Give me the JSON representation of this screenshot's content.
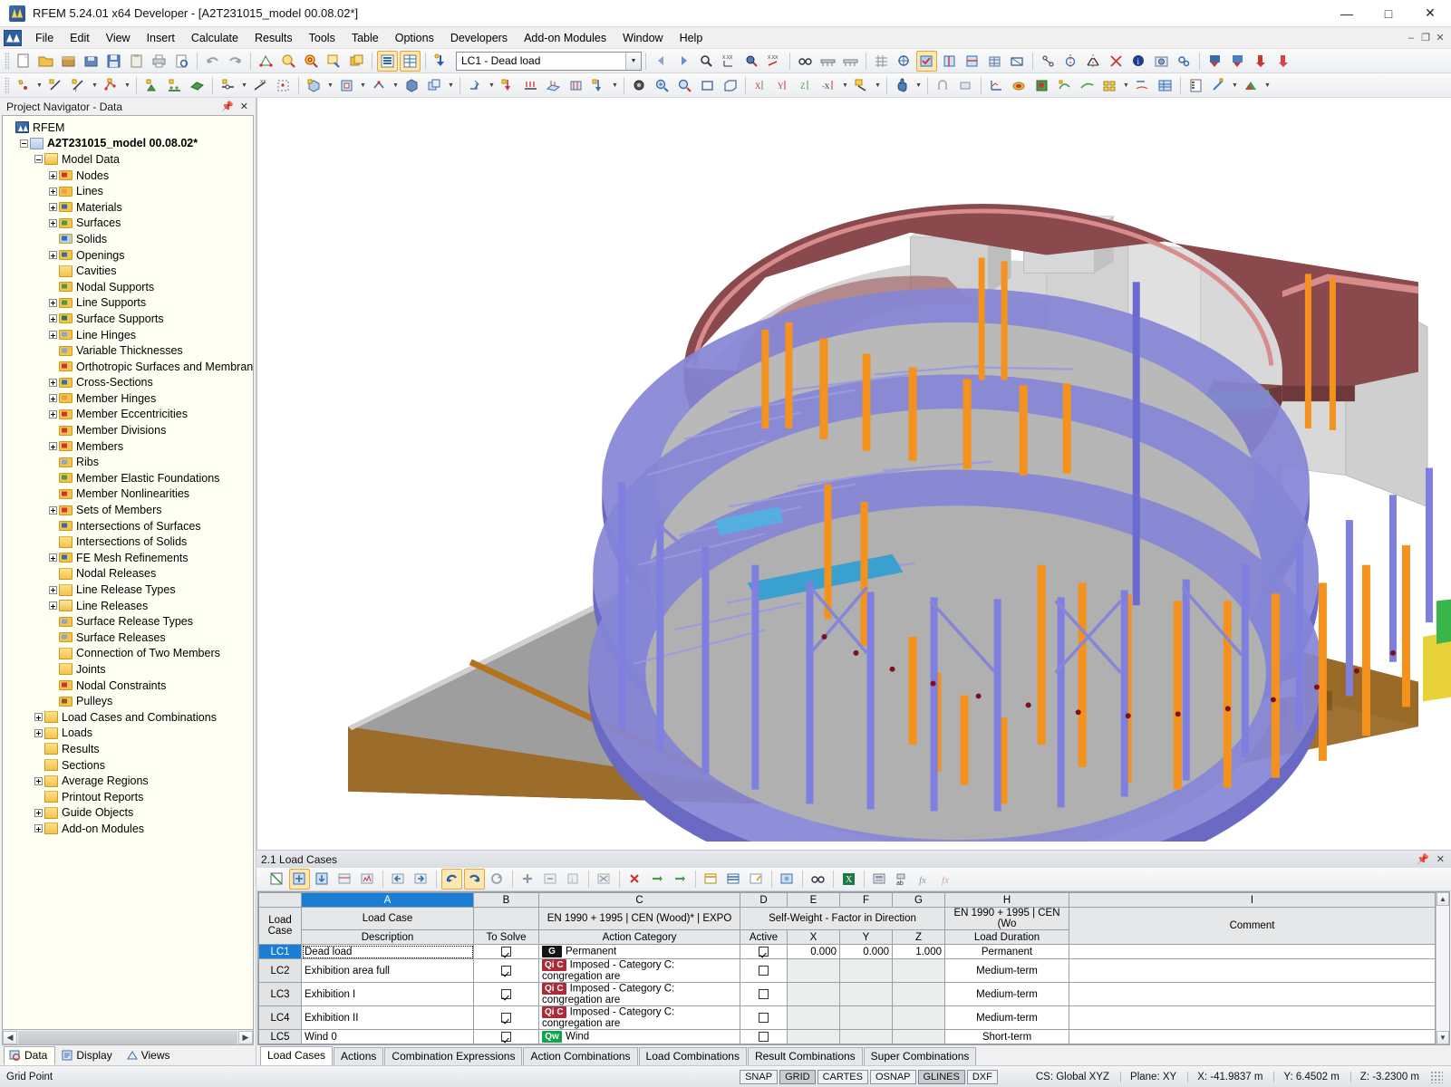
{
  "window": {
    "title": "RFEM 5.24.01 x64 Developer - [A2T231015_model 00.08.02*]",
    "minimize": "—",
    "maximize": "□",
    "close": "✕",
    "mdi_minimize": "–",
    "mdi_restore": "❐",
    "mdi_close": "✕"
  },
  "menu": {
    "logo_icon": "rfem-logo-icon",
    "items": [
      "File",
      "Edit",
      "View",
      "Insert",
      "Calculate",
      "Results",
      "Tools",
      "Table",
      "Options",
      "Developers",
      "Add-on Modules",
      "Window",
      "Help"
    ]
  },
  "toolbar": {
    "load_case_selector": "LC1 - Dead load",
    "row1_icons": [
      "new-file-icon",
      "open-folder-icon",
      "open-package-icon",
      "save-package-icon",
      "save-icon",
      "clipboard-icon",
      "print-icon",
      "print-preview-icon",
      "undo-icon",
      "redo-icon",
      "render-icon",
      "zoom-detail-icon",
      "zoom-target-icon",
      "zoom-window-icon",
      "copy-window-icon",
      "table-list-icon",
      "table-grid-icon",
      "load-case-icon"
    ],
    "row1b_icons": [
      "prev-arrow-icon",
      "next-arrow-icon",
      "pick-point-icon",
      "dimension-icon",
      "target-point-icon",
      "coord-icon",
      "glasses-icon",
      "bridge-icon",
      "bridge2-icon",
      "mesh-icon",
      "fe-mesh-icon",
      "calc-icon",
      "calc2-icon",
      "calc3-icon",
      "building-icon",
      "frame-icon",
      "node-link-icon",
      "circle-mirror-icon",
      "mirror-icon",
      "intersect-icon",
      "info-icon",
      "photo-icon",
      "gears-icon",
      "down-blue-icon",
      "down-blue2-icon",
      "down-red-icon",
      "down-red2-icon"
    ],
    "row2_icons": [
      "node-icon",
      "line-icon",
      "line-dim-icon",
      "polyline-icon",
      "support-icon",
      "support-node-icon",
      "surface-icon",
      "member-hinge-icon",
      "eccentricity-icon",
      "division-icon",
      "solid-icon",
      "opening-icon",
      "member-icon",
      "cube-icon",
      "copy-solid-icon",
      "move-icon",
      "nodal-load-icon",
      "line-load-icon",
      "surface-load-icon",
      "free-load-icon",
      "snap-icon"
    ],
    "row2b_icons": [
      "mesh-gear-icon",
      "zoom-in-icon",
      "zoom-out-icon",
      "box-icon",
      "box3d-icon",
      "axis-x-icon",
      "axis-y-icon",
      "axis-z-icon",
      "axis-xi-icon",
      "render-mode-icon",
      "hand-icon",
      "joint-icon",
      "link-icon",
      "diagram-icon",
      "contour-icon",
      "solid-result-icon",
      "deform-icon",
      "iso-icon",
      "color-table-icon",
      "section-icon",
      "result-table-icon",
      "legend-icon",
      "magic-icon",
      "colors-icon"
    ]
  },
  "navigator": {
    "title": "Project Navigator - Data",
    "pin_icon": "pin-icon",
    "close_icon": "close-icon",
    "tabs": [
      {
        "label": "Data",
        "icon": "data-icon",
        "active": true
      },
      {
        "label": "Display",
        "icon": "display-icon",
        "active": false
      },
      {
        "label": "Views",
        "icon": "views-icon",
        "active": false
      }
    ],
    "tree": [
      {
        "label": "RFEM",
        "depth": 0,
        "toggle": "none",
        "icon": "rfem-icon",
        "bold": false
      },
      {
        "label": "A2T231015_model 00.08.02*",
        "depth": 1,
        "toggle": "minus",
        "icon": "model-icon",
        "bold": true
      },
      {
        "label": "Model Data",
        "depth": 2,
        "toggle": "minus",
        "icon": "folder-open",
        "bold": false
      },
      {
        "label": "Nodes",
        "depth": 3,
        "toggle": "plus",
        "icon": "nodes-icon",
        "bold": false
      },
      {
        "label": "Lines",
        "depth": 3,
        "toggle": "plus",
        "icon": "lines-icon",
        "bold": false
      },
      {
        "label": "Materials",
        "depth": 3,
        "toggle": "plus",
        "icon": "materials-icon",
        "bold": false
      },
      {
        "label": "Surfaces",
        "depth": 3,
        "toggle": "plus",
        "icon": "surfaces-icon",
        "bold": false
      },
      {
        "label": "Solids",
        "depth": 3,
        "toggle": "none",
        "icon": "solids-icon",
        "bold": false
      },
      {
        "label": "Openings",
        "depth": 3,
        "toggle": "plus",
        "icon": "openings-icon",
        "bold": false
      },
      {
        "label": "Cavities",
        "depth": 3,
        "toggle": "none",
        "icon": "folder",
        "bold": false
      },
      {
        "label": "Nodal Supports",
        "depth": 3,
        "toggle": "none",
        "icon": "nodal-supports-icon",
        "bold": false
      },
      {
        "label": "Line Supports",
        "depth": 3,
        "toggle": "plus",
        "icon": "line-supports-icon",
        "bold": false
      },
      {
        "label": "Surface Supports",
        "depth": 3,
        "toggle": "plus",
        "icon": "surface-supports-icon",
        "bold": false
      },
      {
        "label": "Line Hinges",
        "depth": 3,
        "toggle": "plus",
        "icon": "line-hinges-icon",
        "bold": false
      },
      {
        "label": "Variable Thicknesses",
        "depth": 3,
        "toggle": "none",
        "icon": "thickness-icon",
        "bold": false
      },
      {
        "label": "Orthotropic Surfaces and Membranes",
        "depth": 3,
        "toggle": "none",
        "icon": "ortho-icon",
        "bold": false
      },
      {
        "label": "Cross-Sections",
        "depth": 3,
        "toggle": "plus",
        "icon": "cross-sections-icon",
        "bold": false
      },
      {
        "label": "Member Hinges",
        "depth": 3,
        "toggle": "plus",
        "icon": "member-hinges-icon",
        "bold": false
      },
      {
        "label": "Member Eccentricities",
        "depth": 3,
        "toggle": "plus",
        "icon": "eccentricities-icon",
        "bold": false
      },
      {
        "label": "Member Divisions",
        "depth": 3,
        "toggle": "none",
        "icon": "divisions-icon",
        "bold": false
      },
      {
        "label": "Members",
        "depth": 3,
        "toggle": "plus",
        "icon": "members-icon",
        "bold": false
      },
      {
        "label": "Ribs",
        "depth": 3,
        "toggle": "none",
        "icon": "ribs-icon",
        "bold": false
      },
      {
        "label": "Member Elastic Foundations",
        "depth": 3,
        "toggle": "none",
        "icon": "foundations-icon",
        "bold": false
      },
      {
        "label": "Member Nonlinearities",
        "depth": 3,
        "toggle": "none",
        "icon": "nonlinearities-icon",
        "bold": false
      },
      {
        "label": "Sets of Members",
        "depth": 3,
        "toggle": "plus",
        "icon": "sets-icon",
        "bold": false
      },
      {
        "label": "Intersections of Surfaces",
        "depth": 3,
        "toggle": "none",
        "icon": "intersect-surf-icon",
        "bold": false
      },
      {
        "label": "Intersections of Solids",
        "depth": 3,
        "toggle": "none",
        "icon": "folder",
        "bold": false
      },
      {
        "label": "FE Mesh Refinements",
        "depth": 3,
        "toggle": "plus",
        "icon": "fe-mesh-icon",
        "bold": false
      },
      {
        "label": "Nodal Releases",
        "depth": 3,
        "toggle": "none",
        "icon": "folder",
        "bold": false
      },
      {
        "label": "Line Release Types",
        "depth": 3,
        "toggle": "plus",
        "icon": "folder",
        "bold": false
      },
      {
        "label": "Line Releases",
        "depth": 3,
        "toggle": "plus",
        "icon": "folder-open",
        "bold": false
      },
      {
        "label": "Surface Release Types",
        "depth": 3,
        "toggle": "none",
        "icon": "surface-release-icon",
        "bold": false
      },
      {
        "label": "Surface Releases",
        "depth": 3,
        "toggle": "none",
        "icon": "surface-release-icon",
        "bold": false
      },
      {
        "label": "Connection of Two Members",
        "depth": 3,
        "toggle": "none",
        "icon": "folder",
        "bold": false
      },
      {
        "label": "Joints",
        "depth": 3,
        "toggle": "none",
        "icon": "folder",
        "bold": false
      },
      {
        "label": "Nodal Constraints",
        "depth": 3,
        "toggle": "none",
        "icon": "constraints-icon",
        "bold": false
      },
      {
        "label": "Pulleys",
        "depth": 3,
        "toggle": "none",
        "icon": "pulleys-icon",
        "bold": false
      },
      {
        "label": "Load Cases and Combinations",
        "depth": 2,
        "toggle": "plus",
        "icon": "folder",
        "bold": false
      },
      {
        "label": "Loads",
        "depth": 2,
        "toggle": "plus",
        "icon": "folder",
        "bold": false
      },
      {
        "label": "Results",
        "depth": 2,
        "toggle": "none",
        "icon": "folder",
        "bold": false
      },
      {
        "label": "Sections",
        "depth": 2,
        "toggle": "none",
        "icon": "folder",
        "bold": false
      },
      {
        "label": "Average Regions",
        "depth": 2,
        "toggle": "plus",
        "icon": "folder",
        "bold": false
      },
      {
        "label": "Printout Reports",
        "depth": 2,
        "toggle": "none",
        "icon": "folder",
        "bold": false
      },
      {
        "label": "Guide Objects",
        "depth": 2,
        "toggle": "plus",
        "icon": "folder",
        "bold": false
      },
      {
        "label": "Add-on Modules",
        "depth": 2,
        "toggle": "plus",
        "icon": "folder",
        "bold": false
      }
    ]
  },
  "table_panel": {
    "title": "2.1 Load Cases",
    "pin_icon": "pin-icon",
    "close_icon": "close-icon",
    "toolbar_icons": [
      "new-table-icon",
      "edit-table-icon",
      "import-icon",
      "filter-icon",
      "chart-icon",
      "prev-page-icon",
      "next-page-icon",
      "undo-icon",
      "redo-icon",
      "refresh-icon",
      "add-row-icon",
      "insert-row-icon",
      "info-row-icon",
      "delete-all-icon",
      "delete-row-icon",
      "remove-left-icon",
      "remove-right-icon",
      "columns-icon",
      "rows-icon",
      "edit-cell-icon",
      "settings-icon",
      "glasses-icon",
      "excel-icon",
      "calculator-icon",
      "sort-icon",
      "fx-icon",
      "fx-del-icon"
    ],
    "column_letters": [
      "A",
      "B",
      "C",
      "D",
      "E",
      "F",
      "G",
      "H",
      "I"
    ],
    "selected_column": "A",
    "headers": {
      "load_case": "Load Case",
      "group_a_top": "Load Case",
      "group_a_sub": "Description",
      "b_sub": "To Solve",
      "group_c_top": "EN 1990 + 1995 | CEN (Wood)* | EXPO",
      "group_c_sub": "Action Category",
      "group_d_top": "Self-Weight  -  Factor in Direction",
      "d_sub": "Active",
      "e_sub": "X",
      "f_sub": "Y",
      "g_sub": "Z",
      "group_h_top": "EN 1990 + 1995 | CEN (Wo",
      "h_sub": "Load Duration",
      "i_sub": "Comment"
    },
    "rows": [
      {
        "id": "LC1",
        "description": "Dead load",
        "to_solve": true,
        "tag": "G",
        "tag_class": "g",
        "action_category": "Permanent",
        "active": true,
        "x": "0.000",
        "y": "0.000",
        "z": "1.000",
        "load_duration": "Permanent",
        "comment": "",
        "selected": true
      },
      {
        "id": "LC2",
        "description": "Exhibition area  full",
        "to_solve": true,
        "tag": "Qi C",
        "tag_class": "qic",
        "action_category": "Imposed - Category C: congregation are",
        "active": false,
        "x": "",
        "y": "",
        "z": "",
        "load_duration": "Medium-term",
        "comment": "",
        "selected": false
      },
      {
        "id": "LC3",
        "description": "Exhibition I",
        "to_solve": true,
        "tag": "Qi C",
        "tag_class": "qic",
        "action_category": "Imposed - Category C: congregation are",
        "active": false,
        "x": "",
        "y": "",
        "z": "",
        "load_duration": "Medium-term",
        "comment": "",
        "selected": false
      },
      {
        "id": "LC4",
        "description": "Exhibition II",
        "to_solve": true,
        "tag": "Qi C",
        "tag_class": "qic",
        "action_category": "Imposed - Category C: congregation are",
        "active": false,
        "x": "",
        "y": "",
        "z": "",
        "load_duration": "Medium-term",
        "comment": "",
        "selected": false
      },
      {
        "id": "LC5",
        "description": "Wind 0",
        "to_solve": true,
        "tag": "Qw",
        "tag_class": "qw",
        "action_category": "Wind",
        "active": false,
        "x": "",
        "y": "",
        "z": "",
        "load_duration": "Short-term",
        "comment": "",
        "selected": false
      }
    ],
    "tabs": [
      {
        "label": "Load Cases",
        "active": true
      },
      {
        "label": "Actions",
        "active": false
      },
      {
        "label": "Combination Expressions",
        "active": false
      },
      {
        "label": "Action Combinations",
        "active": false
      },
      {
        "label": "Load Combinations",
        "active": false
      },
      {
        "label": "Result Combinations",
        "active": false
      },
      {
        "label": "Super Combinations",
        "active": false
      }
    ]
  },
  "statusbar": {
    "left_text": "Grid Point",
    "toggles": [
      {
        "label": "SNAP",
        "pressed": false
      },
      {
        "label": "GRID",
        "pressed": true
      },
      {
        "label": "CARTES",
        "pressed": false
      },
      {
        "label": "OSNAP",
        "pressed": false
      },
      {
        "label": "GLINES",
        "pressed": true
      },
      {
        "label": "DXF",
        "pressed": false
      }
    ],
    "coordinate_system": "CS: Global XYZ",
    "plane": "Plane: XY",
    "x": "X:  -41.9837 m",
    "y": "Y:  6.4502 m",
    "z": "Z:  -3.2300 m"
  },
  "model": {
    "name": "A2T231015_model",
    "colors": {
      "roof_slab": "#8a4a4d",
      "roof_edge": "#d98c8c",
      "floor_slab": "#7b7bd0",
      "floor_slab_light": "#9a9ae0",
      "column_orange": "#f5921e",
      "column_blue": "#7f7fe0",
      "wall_grey": "#d3d3d3",
      "wall_grey_dark": "#a8a8a8",
      "ground_top": "#9e9e9e",
      "ground_side": "#9a6a28",
      "accent_green": "#39b54a",
      "accent_yellow": "#e8d23a",
      "accent_cyan": "#39a0d0",
      "background": "#ffffff"
    }
  }
}
